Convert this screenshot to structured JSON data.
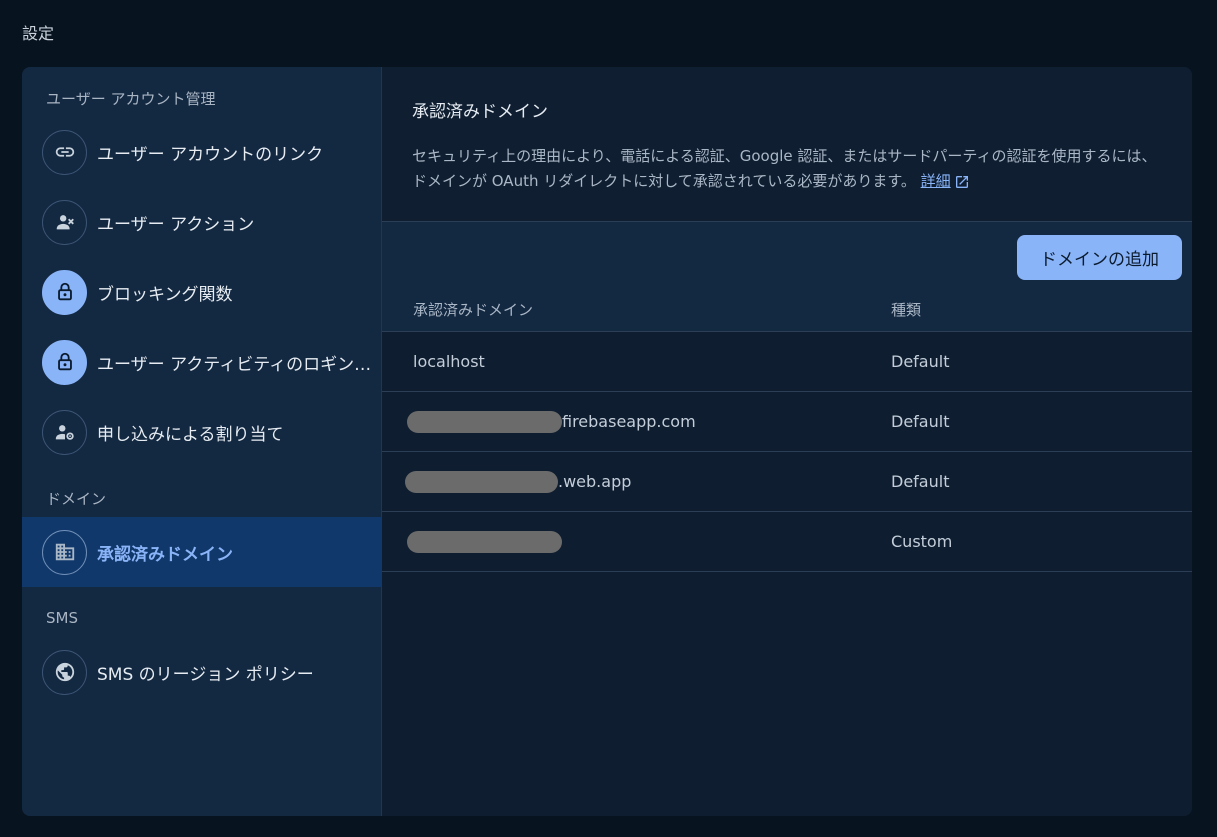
{
  "page": {
    "title": "設定"
  },
  "sidebar": {
    "sections": [
      {
        "label": "ユーザー アカウント管理"
      },
      {
        "label": "ドメイン"
      },
      {
        "label": "SMS"
      }
    ],
    "items": [
      {
        "label": "ユーザー アカウントのリンク",
        "icon": "link-icon"
      },
      {
        "label": "ユーザー アクション",
        "icon": "person-off-icon"
      },
      {
        "label": "ブロッキング関数",
        "icon": "lock-icon"
      },
      {
        "label": "ユーザー アクティビティのロギン…",
        "icon": "lock-icon"
      },
      {
        "label": "申し込みによる割り当て",
        "icon": "person-gear-icon"
      },
      {
        "label": "承認済みドメイン",
        "icon": "building-icon",
        "active": true
      },
      {
        "label": "SMS のリージョン ポリシー",
        "icon": "globe-icon"
      }
    ]
  },
  "main": {
    "title": "承認済みドメイン",
    "description": "セキュリティ上の理由により、電話による認証、Google 認証、またはサードパーティの認証を使用するには、ドメインが OAuth リダイレクトに対して承認されている必要があります。",
    "learn_more": "詳細",
    "add_button": "ドメインの追加",
    "table": {
      "columns": [
        "承認済みドメイン",
        "種類"
      ],
      "rows": [
        {
          "domain": "localhost",
          "type": "Default"
        },
        {
          "domain": "firebaseapp.com",
          "type": "Default"
        },
        {
          "domain": ".web.app",
          "type": "Default"
        },
        {
          "domain": "",
          "type": "Custom"
        }
      ]
    }
  },
  "colors": {
    "accent": "#8ab4f8",
    "background": "#07131f",
    "sidebar": "#132841",
    "active": "#11386a"
  }
}
